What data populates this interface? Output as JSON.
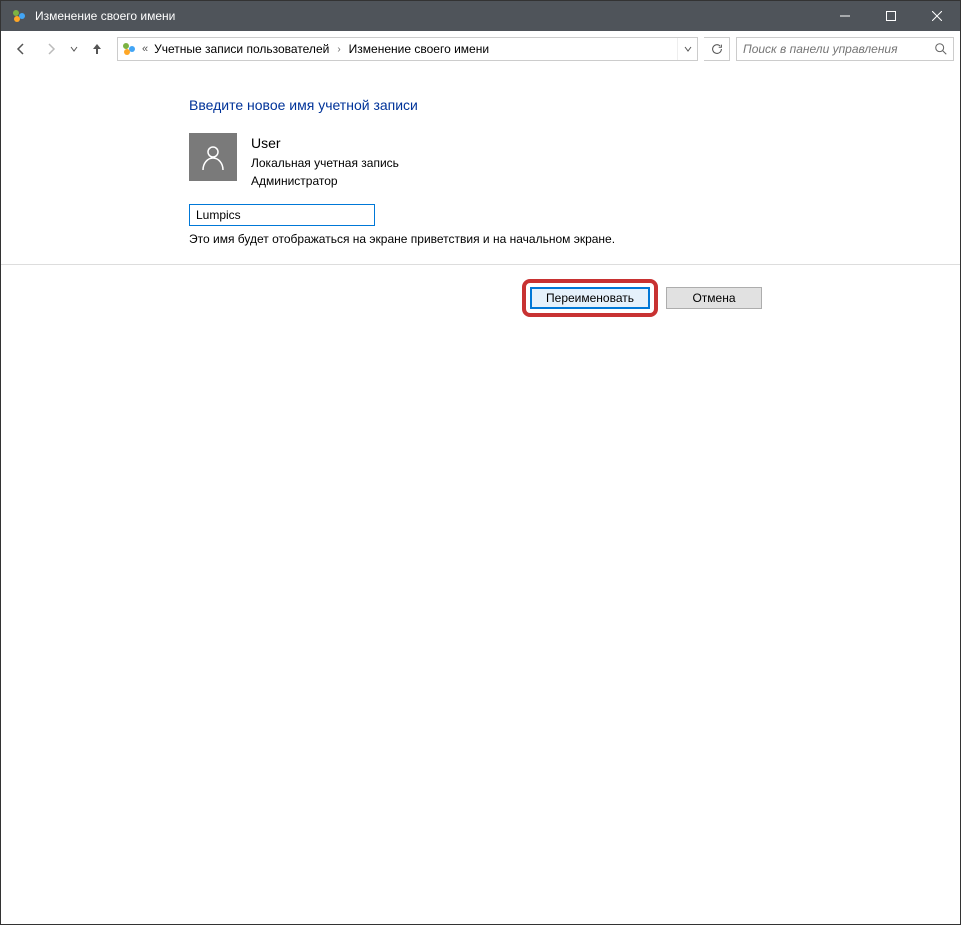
{
  "window": {
    "title": "Изменение своего имени"
  },
  "breadcrumb": {
    "item1": "Учетные записи пользователей",
    "item2": "Изменение своего имени"
  },
  "search": {
    "placeholder": "Поиск в панели управления"
  },
  "content": {
    "heading": "Введите новое имя учетной записи",
    "user_name": "User",
    "account_type": "Локальная учетная запись",
    "role": "Администратор",
    "input_value": "Lumpics",
    "hint": "Это имя будет отображаться на экране приветствия и на начальном экране."
  },
  "buttons": {
    "rename": "Переименовать",
    "cancel": "Отмена"
  }
}
